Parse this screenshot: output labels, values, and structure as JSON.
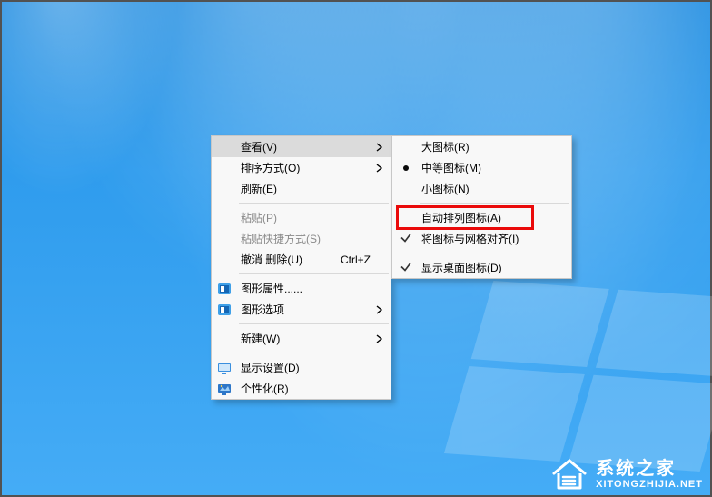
{
  "watermark": {
    "cn": "系统之家",
    "en": "XITONGZHIJIA.NET"
  },
  "main_menu": {
    "view": "查看(V)",
    "sort": "排序方式(O)",
    "refresh": "刷新(E)",
    "paste": "粘贴(P)",
    "paste_shortcut": "粘贴快捷方式(S)",
    "undo_delete": "撤消 删除(U)",
    "undo_shortcut": "Ctrl+Z",
    "gfx_props": "图形属性......",
    "gfx_options": "图形选项",
    "new": "新建(W)",
    "display_settings": "显示设置(D)",
    "personalize": "个性化(R)"
  },
  "view_submenu": {
    "large_icons": "大图标(R)",
    "medium_icons": "中等图标(M)",
    "small_icons": "小图标(N)",
    "auto_arrange": "自动排列图标(A)",
    "align_grid": "将图标与网格对齐(I)",
    "show_desktop_icons": "显示桌面图标(D)"
  }
}
